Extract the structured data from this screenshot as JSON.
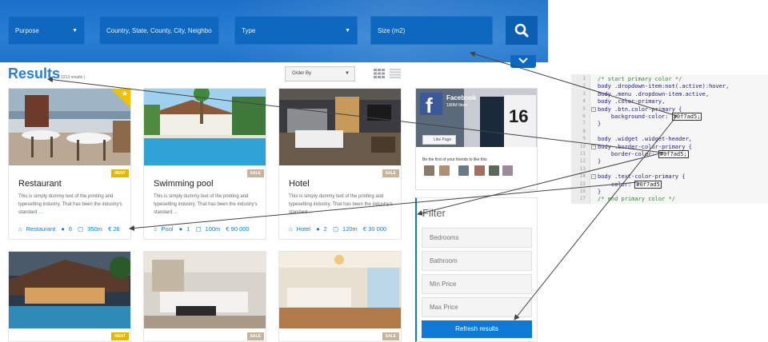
{
  "search": {
    "purpose": "Purpose",
    "location_placeholder": "Country, State, County, City, Neighbo",
    "type": "Type",
    "size": "Size (m2)"
  },
  "results": {
    "title": "Results",
    "count": "( 2213 results )",
    "order_by": "Order By"
  },
  "listings": [
    {
      "title": "Restaurant",
      "badge": "RENT",
      "desc": "This is simply dummy text of the printing and typesetting industry. That has been the industry's standard ...",
      "category": "Restaurant",
      "baths": "6",
      "area": "350m",
      "price": "€ 26",
      "featured": true
    },
    {
      "title": "Swimming pool",
      "badge": "SALE",
      "desc": "This is simply dummy text of the printing and typesetting industry. That has been the industry's standard ...",
      "category": "Pool",
      "baths": "1",
      "area": "100m",
      "price": "€ 90 000",
      "featured": false
    },
    {
      "title": "Hotel",
      "badge": "SALE",
      "desc": "This is simply dummy text of the printing and typesetting industry. That has been the industry's standard ...",
      "category": "Hotel",
      "baths": "2",
      "area": "120m",
      "price": "€ 30 000",
      "featured": false
    },
    {
      "badge": "RENT"
    },
    {
      "badge": "SALE"
    },
    {
      "badge": "SALE"
    }
  ],
  "facebook": {
    "name": "Facebook",
    "likes": "180M likes",
    "like_page": "Like Page",
    "friends_prompt": "Be the first of your friends to like this"
  },
  "filter": {
    "title": "Filter",
    "bedrooms": "Bedrooms",
    "bathroom": "Bathroom",
    "min_price": "Min Price",
    "max_price": "Max Price",
    "refresh": "Refresh results"
  },
  "code": [
    {
      "n": "1",
      "t": "/* start primary color */",
      "c": true
    },
    {
      "n": "2",
      "t": "body .dropdown-item:not(.active):hover,"
    },
    {
      "n": "3",
      "t": "body .menu .dropdown-item.active,"
    },
    {
      "n": "4",
      "t": "body .color-primary,"
    },
    {
      "n": "5",
      "t": "body .btn.color-primary {"
    },
    {
      "n": "6",
      "t": "    background-color: ",
      "h": "#0f7ad5;"
    },
    {
      "n": "7",
      "t": "}"
    },
    {
      "n": "8",
      "t": ""
    },
    {
      "n": "9",
      "t": "body .widget .widget-header,"
    },
    {
      "n": "10",
      "t": "body .border-color-primary {"
    },
    {
      "n": "11",
      "t": "    border-color: ",
      "h": "#0f7ad5;"
    },
    {
      "n": "12",
      "t": "}"
    },
    {
      "n": "13",
      "t": ""
    },
    {
      "n": "14",
      "t": "body .text-color-primary {"
    },
    {
      "n": "15",
      "t": "    color: ",
      "h": "#0f7ad5"
    },
    {
      "n": "16",
      "t": "}"
    },
    {
      "n": "17",
      "t": "/* end primary color */",
      "c": true
    }
  ],
  "colors": {
    "primary": "#0f7ad5",
    "rent": "#e4b800",
    "sale": "#c8b49c"
  }
}
